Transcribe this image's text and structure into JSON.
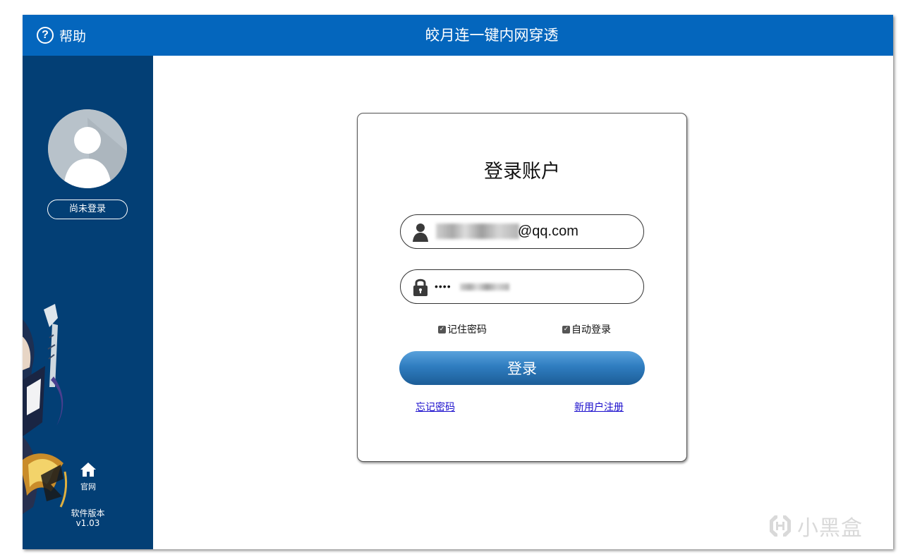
{
  "titlebar": {
    "help_label": "帮助",
    "app_title": "皎月连一键内网穿透",
    "help_icon": "question-circle-icon",
    "background": "#0466bd"
  },
  "sidebar": {
    "background": "#033f75",
    "login_status": "尚未登录",
    "home_label": "官网",
    "home_icon": "home-icon",
    "version_label": "软件版本",
    "version_number": "v1.03"
  },
  "login": {
    "title": "登录账户",
    "username_value": "@qq.com",
    "password_value": "••••",
    "user_icon": "user-icon",
    "lock_icon": "lock-icon",
    "remember_password_label": "记住密码",
    "remember_password_checked": true,
    "auto_login_label": "自动登录",
    "auto_login_checked": true,
    "login_button": "登录",
    "forgot_password_link": "忘记密码",
    "register_link": "新用户注册",
    "link_color": "#1a0dcc"
  },
  "watermark": {
    "text": "小黑盒",
    "icon": "xiaoheihe-logo-icon"
  }
}
